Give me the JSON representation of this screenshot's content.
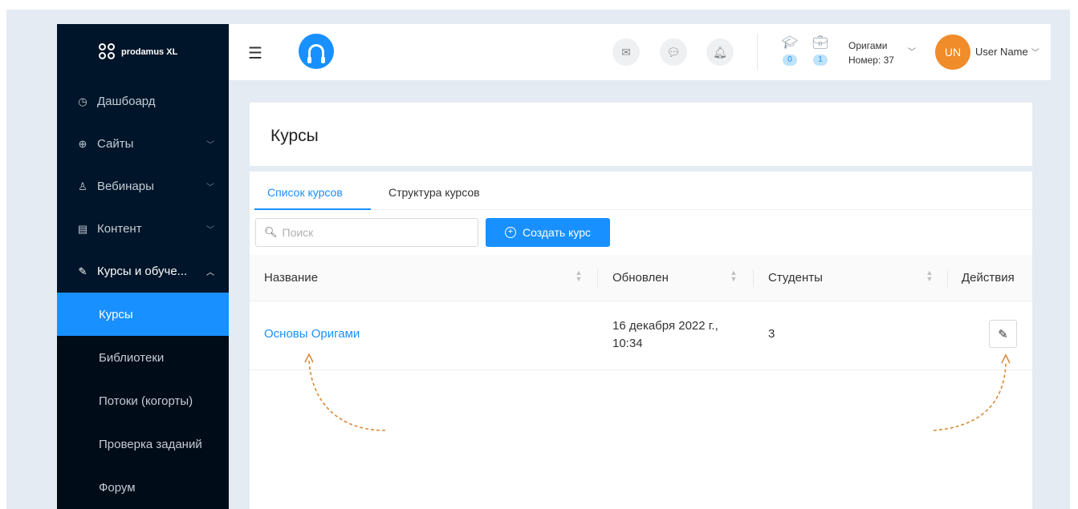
{
  "brand": {
    "logo_text": "prodamus XL"
  },
  "sidebar": {
    "items": [
      {
        "label": "Дашбоард",
        "icon": "dashboard-icon",
        "glyph": "◷"
      },
      {
        "label": "Сайты",
        "icon": "globe-icon",
        "glyph": "⊕"
      },
      {
        "label": "Вебинары",
        "icon": "webinar-icon",
        "glyph": "♙"
      },
      {
        "label": "Контент",
        "icon": "content-icon",
        "glyph": "▤"
      },
      {
        "label": "Курсы и обуче...",
        "icon": "edit-square-icon",
        "glyph": "✎"
      }
    ],
    "subitems": [
      {
        "label": "Курсы",
        "active": true
      },
      {
        "label": "Библиотеки"
      },
      {
        "label": "Потоки (когорты)"
      },
      {
        "label": "Проверка заданий"
      },
      {
        "label": "Форум"
      }
    ]
  },
  "header": {
    "stats": [
      {
        "icon": "graduation-cap-icon",
        "count": "0"
      },
      {
        "icon": "briefcase-icon",
        "count": "1"
      }
    ],
    "account": {
      "name": "Оригами",
      "number": "Номер: 37"
    },
    "user": {
      "initials": "UN",
      "name": "User Name"
    }
  },
  "page": {
    "title": "Курсы"
  },
  "tabs": [
    {
      "label": "Список курсов",
      "active": true
    },
    {
      "label": "Структура курсов"
    }
  ],
  "search": {
    "placeholder": "Поиск",
    "value": ""
  },
  "toolbar": {
    "create_label": "Создать курс"
  },
  "table": {
    "columns": [
      "Название",
      "Обновлен",
      "Студенты",
      "Действия"
    ],
    "rows": [
      {
        "name": "Основы Оригами",
        "updated_line1": "16 декабря 2022 г.,",
        "updated_line2": "10:34",
        "students": "3"
      }
    ]
  },
  "colors": {
    "accent": "#1890ff",
    "sidebar_bg": "#001529",
    "avatar": "#f08c2a",
    "annotation": "#d98b3a"
  }
}
